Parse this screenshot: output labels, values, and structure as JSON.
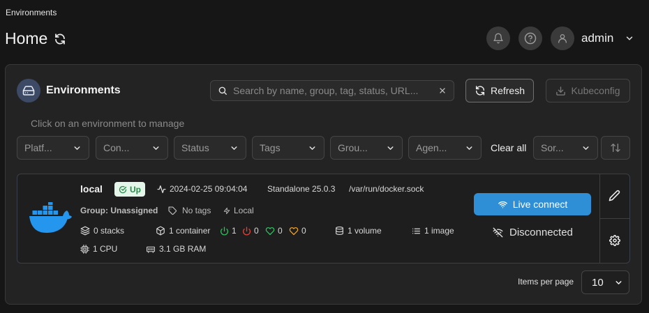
{
  "header": {
    "breadcrumb": "Environments",
    "title": "Home",
    "user_name": "admin"
  },
  "panel": {
    "title": "Environments",
    "search_placeholder": "Search by name, group, tag, status, URL...",
    "refresh_label": "Refresh",
    "kubeconfig_label": "Kubeconfig",
    "hint": "Click on an environment to manage"
  },
  "filters": {
    "items": [
      "Platf...",
      "Con...",
      "Status",
      "Tags",
      "Grou...",
      "Agen..."
    ],
    "clear_label": "Clear all",
    "sort_label": "Sor..."
  },
  "environment": {
    "name": "local",
    "status": "Up",
    "heartbeat": "2024-02-25 09:04:04",
    "type_version": "Standalone 25.0.3",
    "url": "/var/run/docker.sock",
    "group": "Group: Unassigned",
    "tags": "No tags",
    "connection": "Local",
    "stacks": "0 stacks",
    "containers": "1 container",
    "running": "1",
    "stopped": "0",
    "healthy": "0",
    "unhealthy": "0",
    "volumes": "1 volume",
    "images": "1 image",
    "cpu": "1 CPU",
    "ram": "3.1 GB RAM",
    "live_connect_label": "Live connect",
    "connection_state": "Disconnected"
  },
  "pagination": {
    "items_per_page_label": "Items per page",
    "items_per_page_value": "10"
  },
  "colors": {
    "accent_blue": "#2f8fd6",
    "status_up_bg": "#e3f6e9",
    "status_up_text": "#2b8a4b",
    "docker_blue": "#2496ed",
    "running_green": "#2fbf5d",
    "stopped_red": "#e0443a",
    "healthy_green": "#2fbf5d",
    "unhealthy_orange": "#f0a020"
  }
}
